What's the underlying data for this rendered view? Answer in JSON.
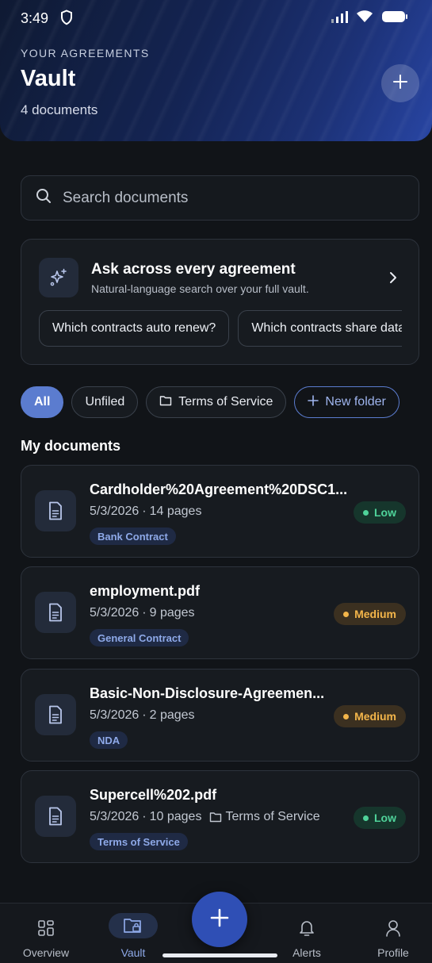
{
  "status": {
    "time": "3:49"
  },
  "header": {
    "eyebrow": "YOUR AGREEMENTS",
    "title": "Vault",
    "subtitle": "4 documents"
  },
  "search": {
    "placeholder": "Search documents",
    "value": ""
  },
  "ask": {
    "title": "Ask across every agreement",
    "subtitle": "Natural-language search over your full vault.",
    "prompts": [
      "Which contracts auto renew?",
      "Which contracts share data?"
    ]
  },
  "filters": {
    "all": "All",
    "unfiled": "Unfiled",
    "folder": "Terms of Service",
    "new_folder": "New folder"
  },
  "section_title": "My documents",
  "documents": [
    {
      "name": "Cardholder%20Agreement%20DSC1...",
      "date": "5/3/2026",
      "pages": "14 pages",
      "folder": "",
      "tag": "Bank Contract",
      "risk": "Low"
    },
    {
      "name": "employment.pdf",
      "date": "5/3/2026",
      "pages": "9 pages",
      "folder": "",
      "tag": "General Contract",
      "risk": "Medium"
    },
    {
      "name": "Basic-Non-Disclosure-Agreemen...",
      "date": "5/3/2026",
      "pages": "2 pages",
      "folder": "",
      "tag": "NDA",
      "risk": "Medium"
    },
    {
      "name": "Supercell%202.pdf",
      "date": "5/3/2026",
      "pages": "10 pages",
      "folder": "Terms of Service",
      "tag": "Terms of Service",
      "risk": "Low"
    }
  ],
  "meta_separator": "·",
  "nav": {
    "overview": "Overview",
    "vault": "Vault",
    "alerts": "Alerts",
    "profile": "Profile"
  },
  "colors": {
    "accent": "#5b7ccf",
    "fab": "#2f4fb5",
    "risk_low": "#4fd39a",
    "risk_medium": "#f3b54a",
    "background": "#111418"
  },
  "icons": {
    "header_add": "plus-icon",
    "search": "search-icon",
    "ask": "sparkle-icon",
    "document": "document-icon",
    "folder": "folder-icon"
  }
}
